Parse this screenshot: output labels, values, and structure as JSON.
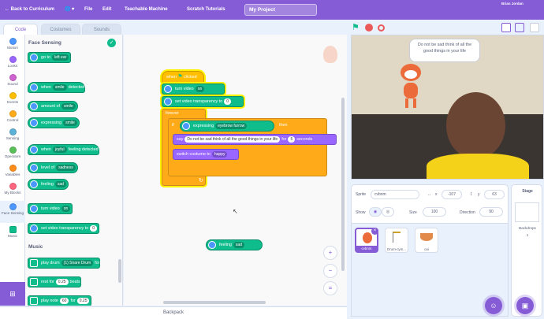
{
  "menubar": {
    "back_label": "← Back to Curriculum",
    "globe": "🌐 ▾",
    "file": "File",
    "edit": "Edit",
    "tm": "Teachable Machine",
    "tutorials": "Scratch Tutorials",
    "project_title": "My Project",
    "user": "Brian Jordan"
  },
  "tabs": {
    "code": "Code",
    "costumes": "Costumes",
    "sounds": "Sounds"
  },
  "categories": [
    "Motion",
    "Looks",
    "Sound",
    "Events",
    "Control",
    "Sensing",
    "Operators",
    "Variables",
    "My Blocks",
    "Face Sensing",
    "Music"
  ],
  "category_colors": [
    "#4c97ff",
    "#9966ff",
    "#cf63cf",
    "#ffbf00",
    "#ffab19",
    "#5cb1d6",
    "#59c059",
    "#ff8c1a",
    "#ff6680",
    "#4c97ff",
    "#0fbd8c"
  ],
  "palette": {
    "title": "Face Sensing",
    "music_title": "Music",
    "b1": "go to",
    "b1_dd": "left ear",
    "b2": "when",
    "b2_dd": "smile",
    "b2_t": "detected",
    "b3": "amount of",
    "b3_dd": "smile",
    "b4": "expressing",
    "b4_dd": "smile",
    "b5": "when",
    "b5_dd": "joyful",
    "b5_t": "feeling detected",
    "b6": "level of",
    "b6_dd": "sadness",
    "b7": "feeling",
    "b7_dd": "sad",
    "b8": "turn video",
    "b8_dd": "on",
    "b9": "set video transparency to",
    "b9_v": "0",
    "m1": "play drum",
    "m1_dd": "(1) Snare Drum",
    "m1_t": "for",
    "m2": "rest for",
    "m2_v": "0.25",
    "m2_t": "beats",
    "m3": "play note",
    "m3_v": "60",
    "m3_t": "for",
    "m3_v2": "0.25"
  },
  "script": {
    "hat": "when",
    "hat_t": "clicked",
    "s1": "turn video",
    "s1_dd": "on",
    "s2": "set video transparency to",
    "s2_v": "0",
    "forever": "forever",
    "if": "if",
    "then": "then",
    "cond": "expressing",
    "cond_dd": "eyebrow furrow",
    "say": "say",
    "say_v": "Do not be sad think of all the good things in your life",
    "say_for": "for",
    "say_n": "5",
    "say_sec": "seconds",
    "costume": "switch costume to",
    "costume_dd": "happy",
    "loose": "feeling",
    "loose_dd": "sad"
  },
  "zoom": {
    "in": "+",
    "out": "−",
    "reset": "="
  },
  "stage": {
    "speech": "Do not be sad think of all the good things in your life"
  },
  "sprite": {
    "label_sprite": "Sprite",
    "name": "cvbnm",
    "label_x": "x",
    "x": "-107",
    "label_y": "y",
    "y": "63",
    "label_show": "Show",
    "label_size": "Size",
    "size": "100",
    "label_direction": "Direction",
    "direction": "90",
    "thumbs": [
      "cvbnm",
      "Drum-cym...",
      "ooi"
    ]
  },
  "stage_panel": {
    "title": "Stage",
    "backdrops_label": "Backdrops",
    "backdrops_count": "1"
  },
  "backpack": "Backpack"
}
